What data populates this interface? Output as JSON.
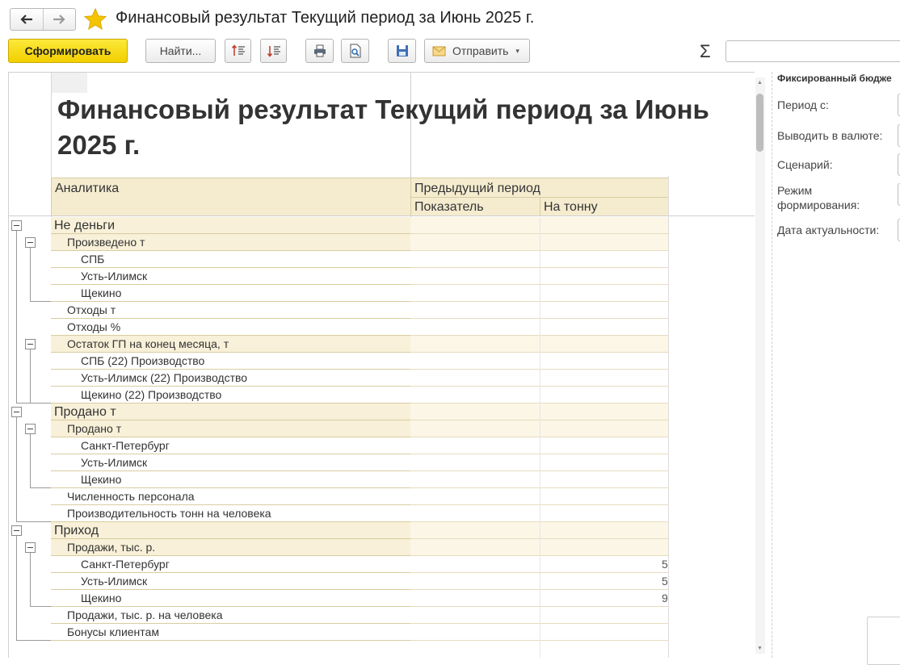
{
  "window": {
    "title": "Финансовый результат Текущий период  за Июнь 2025 г."
  },
  "toolbar": {
    "generate_label": "Сформировать",
    "find_label": "Найти...",
    "send_label": "Отправить",
    "sigma": "Σ"
  },
  "report": {
    "title": "Финансовый результат Текущий период за Июнь 2025 г.",
    "headers": {
      "analytics": "Аналитика",
      "previous_period": "Предыдущий период",
      "indicator": "Показатель",
      "per_ton": "На тонну"
    },
    "rows": [
      {
        "label": "Не деньги",
        "level": 0
      },
      {
        "label": "Произведено т",
        "level": 1
      },
      {
        "label": "СПБ",
        "level": 2
      },
      {
        "label": "Усть-Илимск",
        "level": 2
      },
      {
        "label": "Щекино",
        "level": 2
      },
      {
        "label": "Отходы т",
        "level": 1
      },
      {
        "label": "Отходы %",
        "level": 1
      },
      {
        "label": "Остаток ГП на конец месяца, т",
        "level": 1
      },
      {
        "label": "СПБ (22) Производство",
        "level": 2
      },
      {
        "label": "Усть-Илимск (22) Производство",
        "level": 2
      },
      {
        "label": "Щекино (22) Производство",
        "level": 2
      },
      {
        "label": "Продано т",
        "level": 0
      },
      {
        "label": "Продано т",
        "level": 1
      },
      {
        "label": "Санкт-Петербург",
        "level": 2
      },
      {
        "label": "Усть-Илимск",
        "level": 2
      },
      {
        "label": "Щекино",
        "level": 2
      },
      {
        "label": "Численность персонала",
        "level": 1
      },
      {
        "label": "Производительность тонн на человека",
        "level": 1
      },
      {
        "label": "Приход",
        "level": 0
      },
      {
        "label": "Продажи, тыс. р.",
        "level": 1
      },
      {
        "label": "Санкт-Петербург",
        "level": 2
      },
      {
        "label": "Усть-Илимск",
        "level": 2
      },
      {
        "label": "Щекино",
        "level": 2
      },
      {
        "label": "Продажи, тыс. р. на человека",
        "level": 1
      },
      {
        "label": "Бонусы клиентам",
        "level": 1
      }
    ],
    "edge_fragments": [
      "5",
      "5",
      "9"
    ]
  },
  "settings": {
    "title": "Фиксированный бюдже",
    "period_label": "Период с:",
    "currency_label": "Выводить в валюте:",
    "scenario_label": "Сценарий:",
    "mode_label": "Режим формирования:",
    "actual_date_label": "Дата актуальности:"
  }
}
